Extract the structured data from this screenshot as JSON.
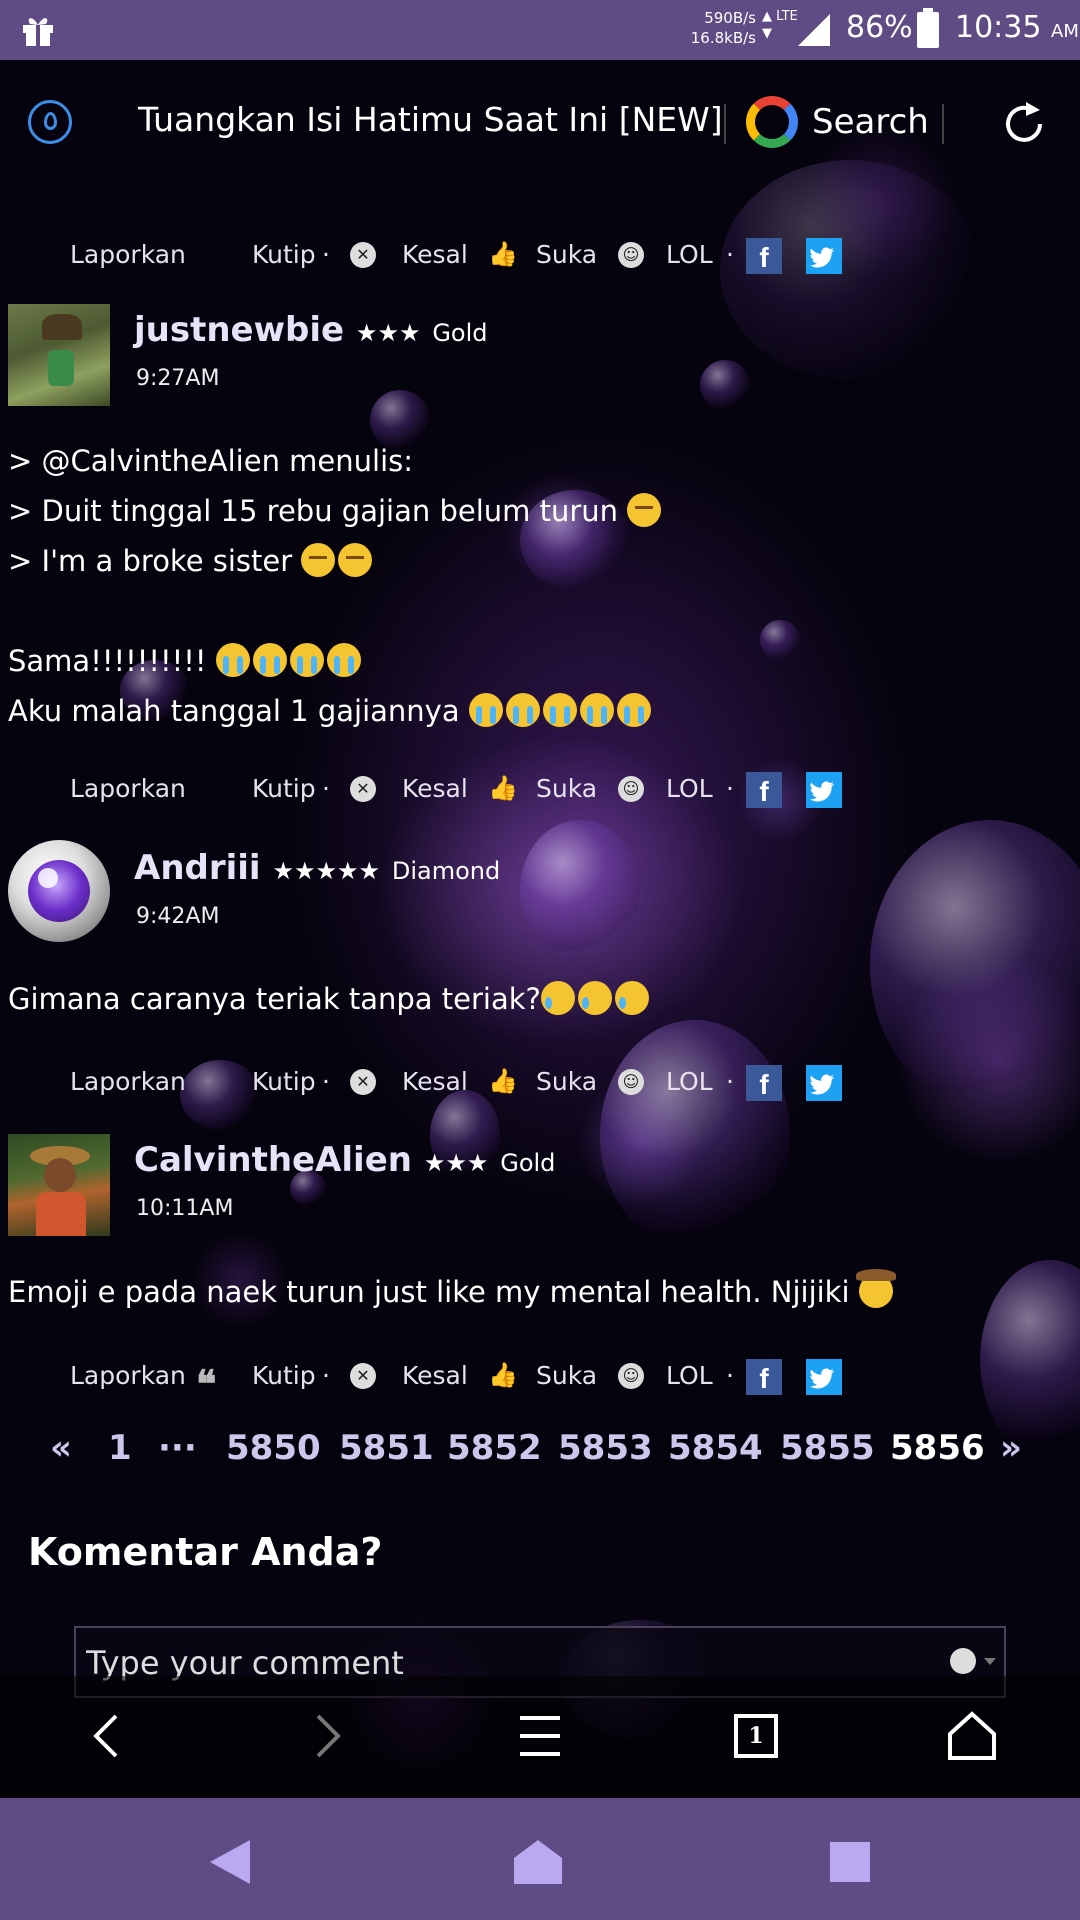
{
  "status_bar": {
    "speed_up": "590B/s",
    "speed_down": "16.8kB/s",
    "network": "LTE",
    "battery": "86%",
    "time": "10:35",
    "ampm": "AM"
  },
  "toolbar": {
    "title": "Tuangkan Isi Hatimu Saat Ini [NEW]",
    "search_label": "Search"
  },
  "actions": {
    "report": "Laporkan",
    "quote": "Kutip",
    "angry": "Kesal",
    "like": "Suka",
    "lol": "LOL",
    "sep": "·"
  },
  "posts": [
    {
      "user": "justnewbie",
      "stars": "★★★",
      "rank": "Gold",
      "time": "9:27AM",
      "lines": [
        "> @CalvintheAlien menulis:",
        "> Duit tinggal 15 rebu gajian belum turun",
        "> I'm a broke sister",
        "",
        "Sama!!!!!!!!!!",
        "Aku malah tanggal 1 gajiannya"
      ]
    },
    {
      "user": "Andriii",
      "stars": "★★★★★",
      "rank": "Diamond",
      "time": "9:42AM",
      "lines": [
        "Gimana caranya teriak tanpa teriak?"
      ]
    },
    {
      "user": "CalvintheAlien",
      "stars": "★★★",
      "rank": "Gold",
      "time": "10:11AM",
      "lines": [
        "Emoji e pada naek turun just like my mental health. Njijiki"
      ]
    }
  ],
  "pagination": {
    "prev": "«",
    "first": "1",
    "ellipsis": "···",
    "pages": [
      "5850",
      "5851",
      "5852",
      "5853",
      "5854",
      "5855",
      "5856"
    ],
    "current": "5856",
    "next": "»"
  },
  "comment": {
    "heading": "Komentar Anda?",
    "placeholder": "Type your comment"
  },
  "browser_nav": {
    "tabs_count": "1"
  },
  "colors": {
    "status_bar": "#5f4c84",
    "accent_blue": "#3d8ee8",
    "facebook": "#3b5998",
    "twitter": "#1da1f2"
  }
}
